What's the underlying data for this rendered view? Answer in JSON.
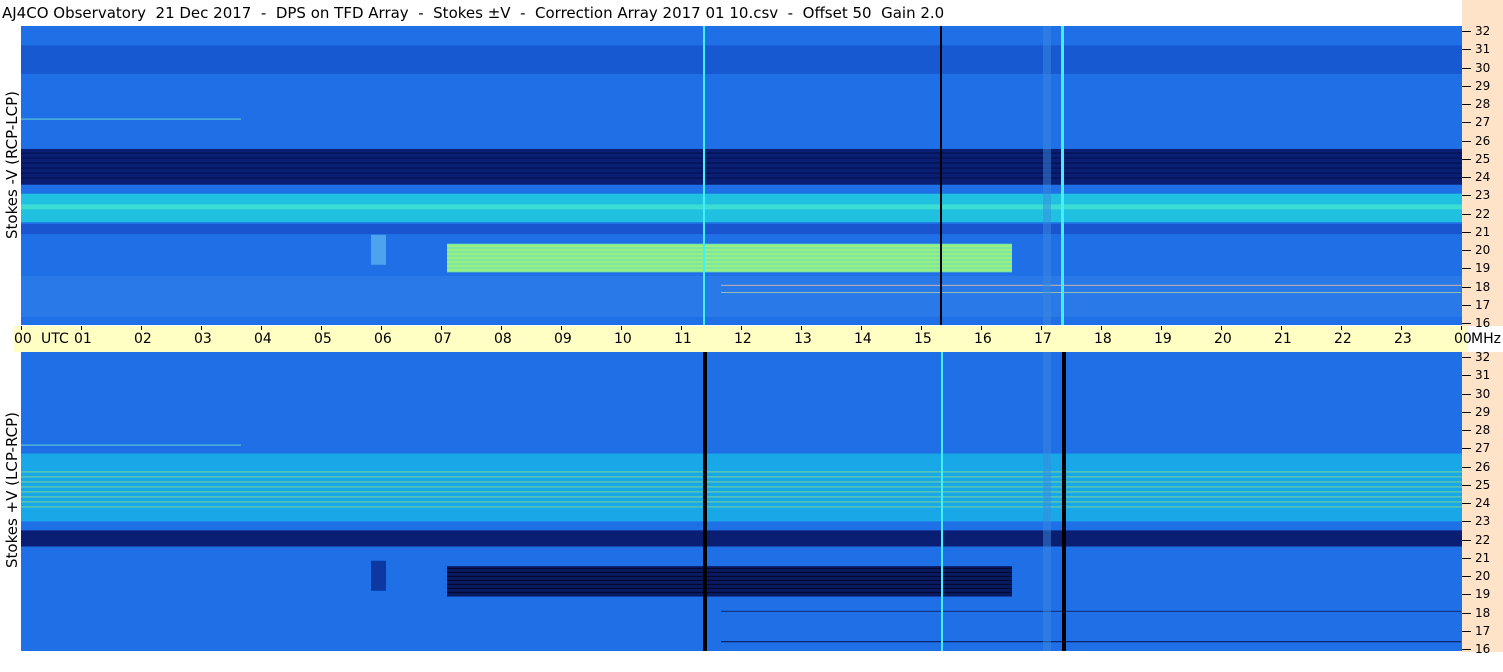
{
  "header": {
    "title": "AJ4CO Observatory  21 Dec 2017  -  DPS on TFD Array  -  Stokes ±V  -  Correction Array 2017 01 10.csv  -  Offset 50  Gain 2.0"
  },
  "panels": {
    "top_label": "Stokes -V (RCP-LCP)",
    "bottom_label": "Stokes +V (LCP-RCP)"
  },
  "time_axis": {
    "labels": [
      "00",
      "01",
      "02",
      "03",
      "04",
      "05",
      "06",
      "07",
      "08",
      "09",
      "10",
      "11",
      "12",
      "13",
      "14",
      "15",
      "16",
      "17",
      "18",
      "19",
      "20",
      "21",
      "22",
      "23",
      "00"
    ],
    "utc_label": "UTC",
    "unit_label": "MHz"
  },
  "freq_axis": {
    "labels": [
      "32",
      "31",
      "30",
      "29",
      "28",
      "27",
      "26",
      "25",
      "24",
      "23",
      "22",
      "21",
      "20",
      "19",
      "18",
      "17",
      "16"
    ]
  },
  "colors": {
    "background": "#1f6fe6",
    "dark_band": "#0a1e73",
    "bright_band": "#3fe0d0",
    "hot_band": "#c8f55a",
    "time_axis_bg": "#ffffc4",
    "freq_axis_bg": "#ffe3c8"
  }
}
